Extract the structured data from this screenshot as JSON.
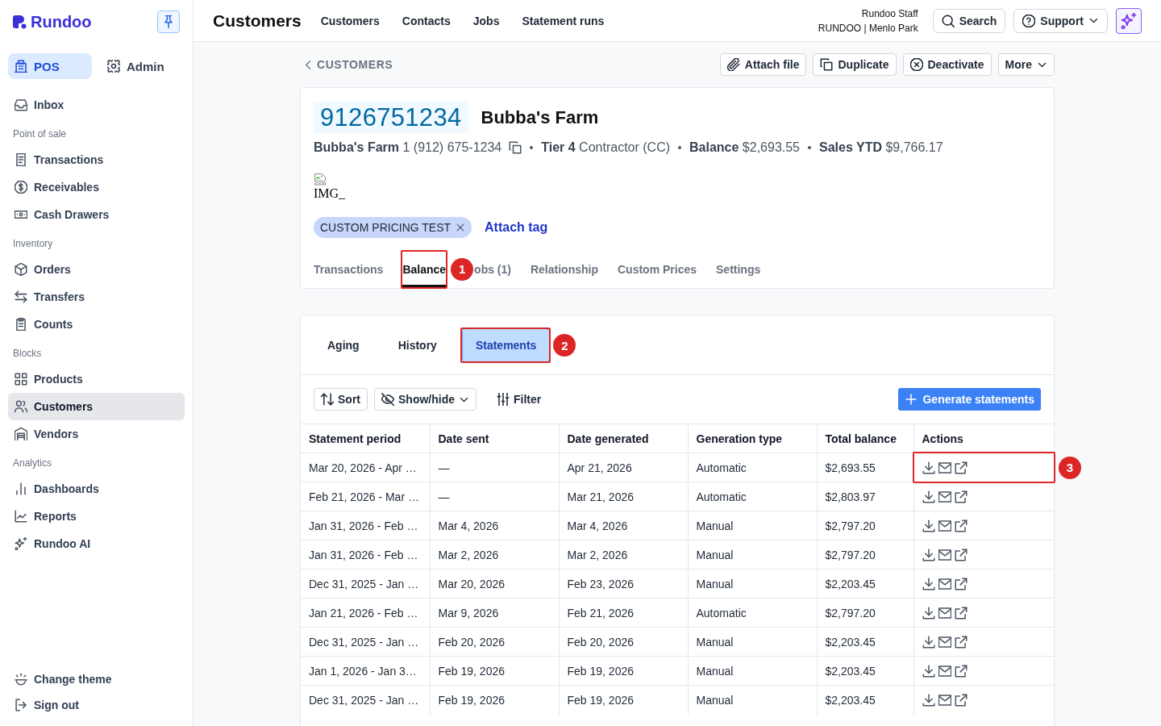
{
  "sidebar": {
    "brand": "Rundoo",
    "modes": [
      {
        "label": "POS",
        "selected": true
      },
      {
        "label": "Admin",
        "selected": false
      }
    ],
    "items": [
      {
        "label": "Inbox",
        "selected": false
      }
    ],
    "sections": [
      {
        "heading": "Point of sale",
        "items": [
          {
            "label": "Transactions",
            "selected": false
          },
          {
            "label": "Receivables",
            "selected": false
          },
          {
            "label": "Cash Drawers",
            "selected": false
          }
        ]
      },
      {
        "heading": "Inventory",
        "items": [
          {
            "label": "Orders",
            "selected": false
          },
          {
            "label": "Transfers",
            "selected": false
          },
          {
            "label": "Counts",
            "selected": false
          }
        ]
      },
      {
        "heading": "Blocks",
        "items": [
          {
            "label": "Products",
            "selected": false
          },
          {
            "label": "Customers",
            "selected": true
          },
          {
            "label": "Vendors",
            "selected": false
          }
        ]
      },
      {
        "heading": "Analytics",
        "items": [
          {
            "label": "Dashboards",
            "selected": false
          },
          {
            "label": "Reports",
            "selected": false
          },
          {
            "label": "Rundoo AI",
            "selected": false
          }
        ]
      }
    ],
    "footer": [
      "Change theme",
      "Sign out"
    ]
  },
  "header": {
    "title": "Customers",
    "nav": [
      "Customers",
      "Contacts",
      "Jobs",
      "Statement runs"
    ],
    "user_name": "Rundoo Staff",
    "user_location": "RUNDOO | Menlo Park",
    "search": "Search",
    "support": "Support"
  },
  "toolbar": {
    "breadcrumb": "CUSTOMERS",
    "actions": [
      {
        "label": "Attach file",
        "kind": "button"
      },
      {
        "label": "Duplicate",
        "kind": "button"
      },
      {
        "label": "Deactivate",
        "kind": "button"
      },
      {
        "label": "More",
        "kind": "menu"
      }
    ]
  },
  "customer": {
    "account_number": "9126751234",
    "name": "Bubba's Farm",
    "details": [
      {
        "text": "**Bubba's Farm** 1 (912) 675-1234",
        "copyable": true
      },
      {
        "text": "**Tier 4** Contractor (CC)"
      },
      {
        "text": "**Balance** $2,693.55"
      },
      {
        "text": "**Sales YTD** $9,766.17"
      }
    ],
    "image_alt": "IMG_",
    "tags": [
      {
        "label": "CUSTOM PRICING TEST",
        "removable": true
      }
    ],
    "attach_tag": "Attach tag"
  },
  "tabs": [
    {
      "label": "Transactions",
      "selected": false
    },
    {
      "label": "Balance",
      "selected": true,
      "callout": "1"
    },
    {
      "label": "obs (1)",
      "selected": false
    },
    {
      "label": "Relationship",
      "selected": false
    },
    {
      "label": "Custom Prices",
      "selected": false
    },
    {
      "label": "Settings",
      "selected": false
    }
  ],
  "balance": {
    "subtabs": [
      {
        "label": "Aging",
        "selected": false
      },
      {
        "label": "History",
        "selected": false
      },
      {
        "label": "Statements",
        "selected": true,
        "callout": "2"
      }
    ],
    "tools": [
      {
        "label": "Sort",
        "kind": "button"
      },
      {
        "label": "Show/hide",
        "kind": "dropdown"
      },
      {
        "label": "Filter",
        "kind": "plain"
      }
    ],
    "generate_button": "Generate statements",
    "table": {
      "columns": [
        "Statement period",
        "Date sent",
        "Date generated",
        "Generation type",
        "Total balance",
        "Actions"
      ],
      "rows": [
        {
          "cells": [
            "Mar 20, 2026 - Apr …",
            "—",
            "Apr 21, 2026",
            "Automatic",
            "$2,693.55"
          ],
          "callout": "3"
        },
        {
          "cells": [
            "Feb 21, 2026 - Mar …",
            "—",
            "Mar 21, 2026",
            "Automatic",
            "$2,803.97"
          ]
        },
        {
          "cells": [
            "Jan 31, 2026 - Feb …",
            "Mar 4, 2026",
            "Mar 4, 2026",
            "Manual",
            "$2,797.20"
          ]
        },
        {
          "cells": [
            "Jan 31, 2026 - Feb …",
            "Mar 2, 2026",
            "Mar 2, 2026",
            "Manual",
            "$2,797.20"
          ]
        },
        {
          "cells": [
            "Dec 31, 2025 - Jan …",
            "Mar 20, 2026",
            "Feb 23, 2026",
            "Manual",
            "$2,203.45"
          ]
        },
        {
          "cells": [
            "Jan 21, 2026 - Feb …",
            "Mar 9, 2026",
            "Feb 21, 2026",
            "Automatic",
            "$2,797.20"
          ]
        },
        {
          "cells": [
            "Dec 31, 2025 - Jan …",
            "Feb 20, 2026",
            "Feb 20, 2026",
            "Manual",
            "$2,203.45"
          ]
        },
        {
          "cells": [
            "Jan 1, 2026 - Jan 3…",
            "Feb 19, 2026",
            "Feb 19, 2026",
            "Manual",
            "$2,203.45"
          ]
        },
        {
          "cells": [
            "Dec 31, 2025 - Jan …",
            "Feb 19, 2026",
            "Feb 19, 2026",
            "Manual",
            "$2,203.45"
          ]
        }
      ]
    }
  }
}
